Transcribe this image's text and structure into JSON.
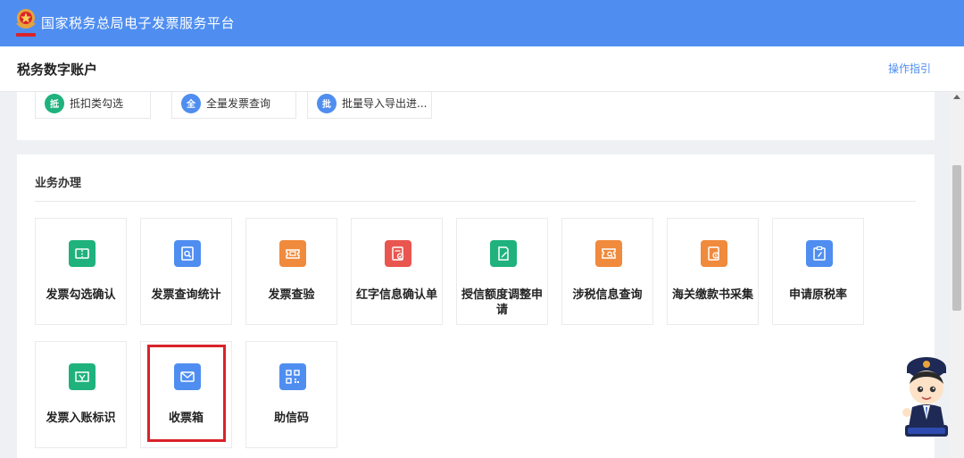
{
  "topbar": {
    "title": "国家税务总局电子发票服务平台"
  },
  "subbar": {
    "account_title": "税务数字账户",
    "guide_link": "操作指引"
  },
  "quick_actions": [
    {
      "badge": "抵",
      "label": "抵扣类勾选",
      "color": "#1fb27c"
    },
    {
      "badge": "全",
      "label": "全量发票查询",
      "color": "#4f8ef0"
    },
    {
      "badge": "批",
      "label": "批量导入导出进...",
      "color": "#4f8ef0"
    }
  ],
  "business": {
    "title": "业务办理",
    "tiles": [
      {
        "label": "发票勾选确认",
        "icon": "ticket-icon",
        "color": "#1fb27c"
      },
      {
        "label": "发票查询统计",
        "icon": "search-document-icon",
        "color": "#4f8ef0"
      },
      {
        "label": "发票查验",
        "icon": "verify-ticket-icon",
        "color": "#f08a3c"
      },
      {
        "label": "红字信息确认单",
        "icon": "red-letter-form-icon",
        "color": "#e8564f"
      },
      {
        "label": "授信额度调整申请",
        "icon": "credit-adjust-icon",
        "color": "#1fb27c"
      },
      {
        "label": "涉税信息查询",
        "icon": "tax-info-search-icon",
        "color": "#f08a3c"
      },
      {
        "label": "海关缴款书采集",
        "icon": "customs-receipt-icon",
        "color": "#f08a3c"
      },
      {
        "label": "申请原税率",
        "icon": "apply-rate-icon",
        "color": "#4f8ef0"
      },
      {
        "label": "发票入账标识",
        "icon": "invoice-booking-icon",
        "color": "#1fb27c"
      },
      {
        "label": "收票箱",
        "icon": "mailbox-icon",
        "color": "#4f8ef0"
      },
      {
        "label": "助信码",
        "icon": "qr-code-icon",
        "color": "#4f8ef0"
      }
    ]
  }
}
